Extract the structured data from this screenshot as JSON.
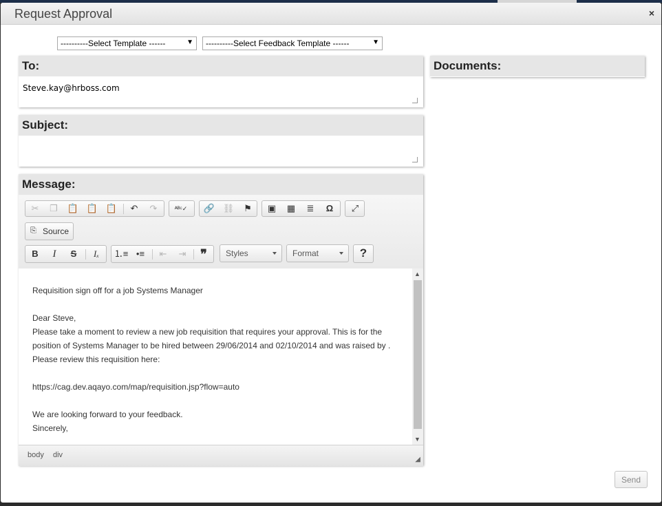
{
  "dialog": {
    "title": "Request Approval",
    "close": "×"
  },
  "templates": {
    "template_select": "----------Select Template ------",
    "feedback_select": "----------Select Feedback Template ------"
  },
  "to": {
    "label": "To:",
    "value": "Steve.kay@hrboss.com"
  },
  "subject": {
    "label": "Subject:",
    "value": ""
  },
  "documents": {
    "label": "Documents:"
  },
  "message": {
    "label": "Message:",
    "toolbar": {
      "source_label": "Source",
      "styles_label": "Styles",
      "format_label": "Format",
      "help_label": "?"
    },
    "body": {
      "line1": "Requisition sign off for a job Systems Manager",
      "line2": "Dear Steve,",
      "line3": "Please take a moment to review a new job requisition that requires your approval. This is for the position of Systems Manager to be hired between 29/06/2014 and 02/10/2014 and was raised by . Please review this requisition here:",
      "line4": "https://cag.dev.aqayo.com/map/requisition.jsp?flow=auto",
      "line5": "We are looking forward to your feedback.",
      "line6": "Sincerely,"
    },
    "status_path": [
      "body",
      "div"
    ]
  },
  "send_label": "Send",
  "colors": {
    "panel_header": "#e6e6e6",
    "dialog_bg": "#ffffff"
  }
}
